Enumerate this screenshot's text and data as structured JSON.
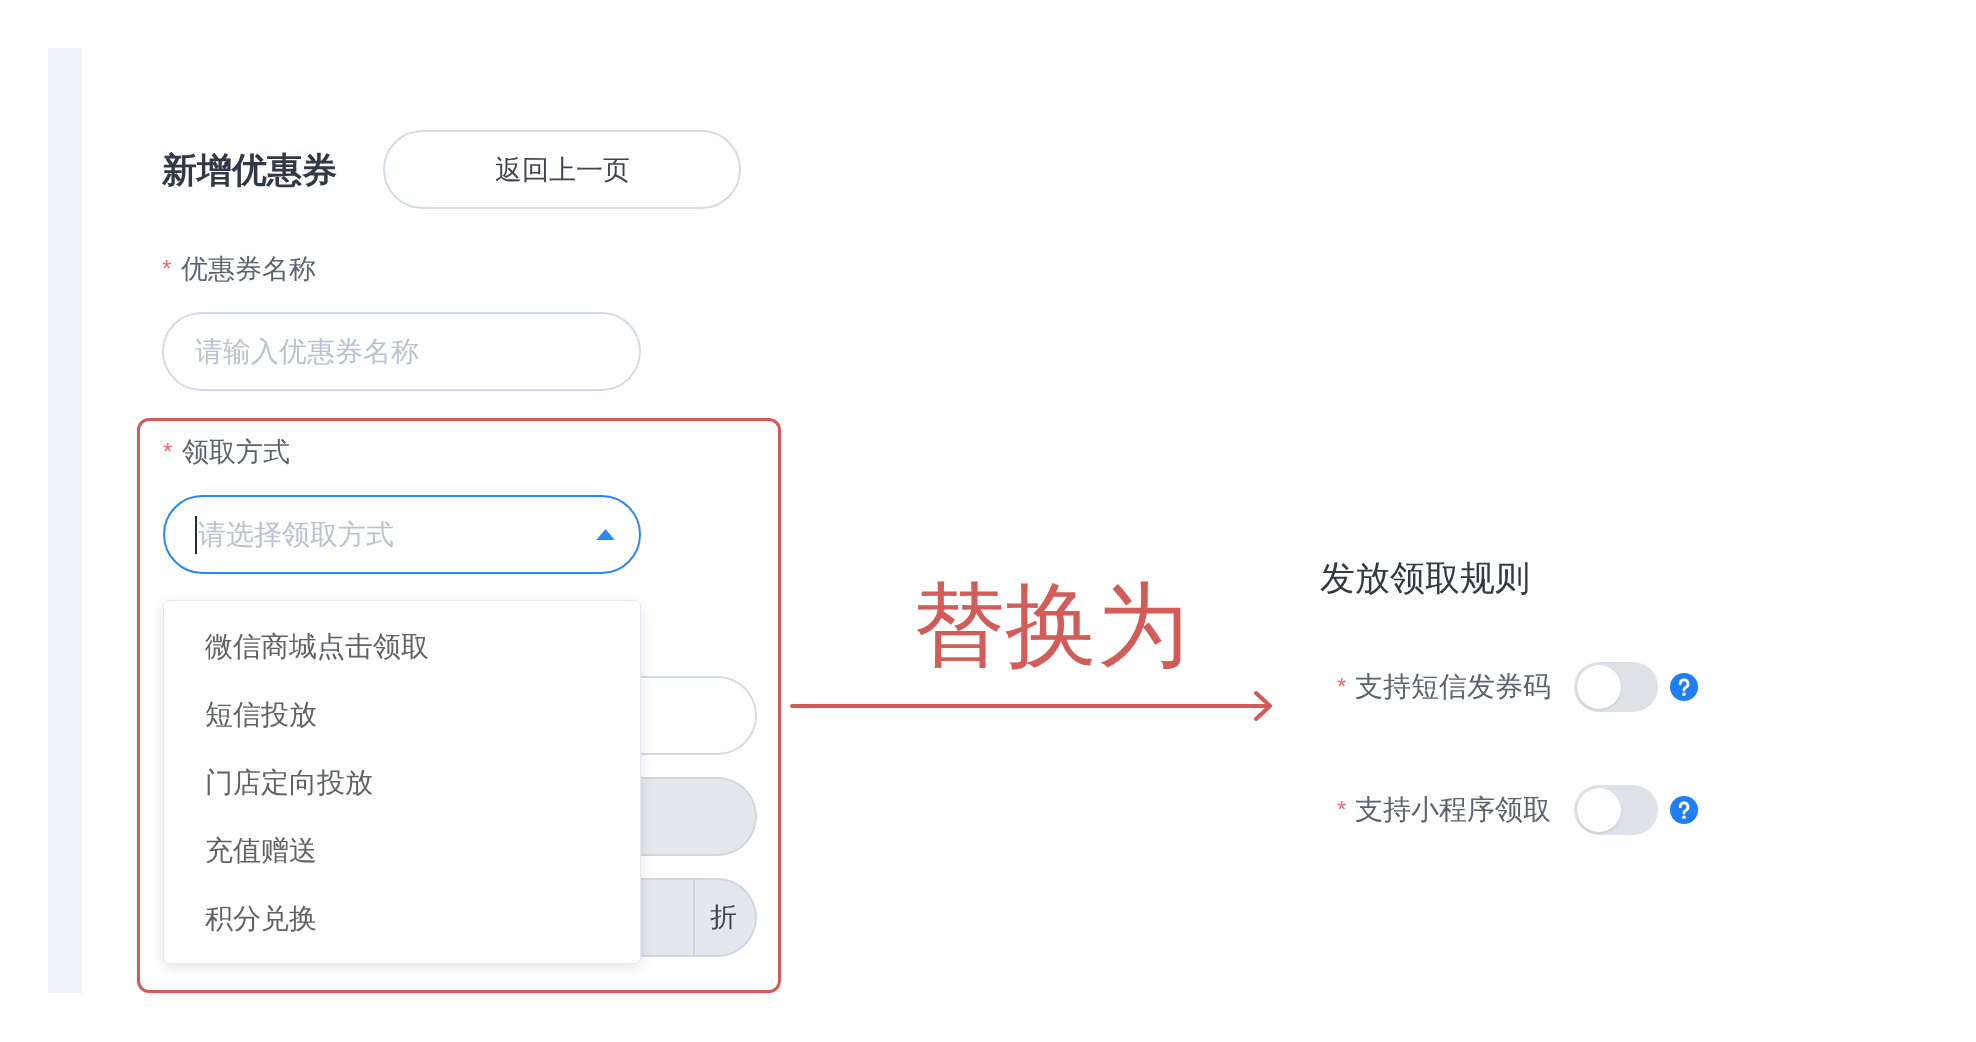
{
  "page": {
    "title": "新增优惠券",
    "back_button": "返回上一页"
  },
  "form": {
    "name_field": {
      "required_mark": "*",
      "label": "优惠券名称",
      "placeholder": "请输入优惠券名称"
    },
    "method_field": {
      "required_mark": "*",
      "label": "领取方式",
      "placeholder": "请选择领取方式",
      "expanded": true,
      "options": [
        {
          "label": "微信商城点击领取",
          "selected": false
        },
        {
          "label": "短信投放",
          "selected": false
        },
        {
          "label": "门店定向投放",
          "selected": false
        },
        {
          "label": "充值赠送",
          "selected": false
        },
        {
          "label": "积分兑换",
          "selected": false
        }
      ]
    },
    "covered_fields": [
      {
        "disabled": false
      },
      {
        "disabled": true
      },
      {
        "disabled": true,
        "suffix": "折"
      }
    ]
  },
  "annotation": {
    "text": "替换为"
  },
  "rules": {
    "title": "发放领取规则",
    "items": [
      {
        "required_mark": "*",
        "label": "支持短信发券码",
        "on": false
      },
      {
        "required_mark": "*",
        "label": "支持小程序领取",
        "on": false
      }
    ]
  }
}
